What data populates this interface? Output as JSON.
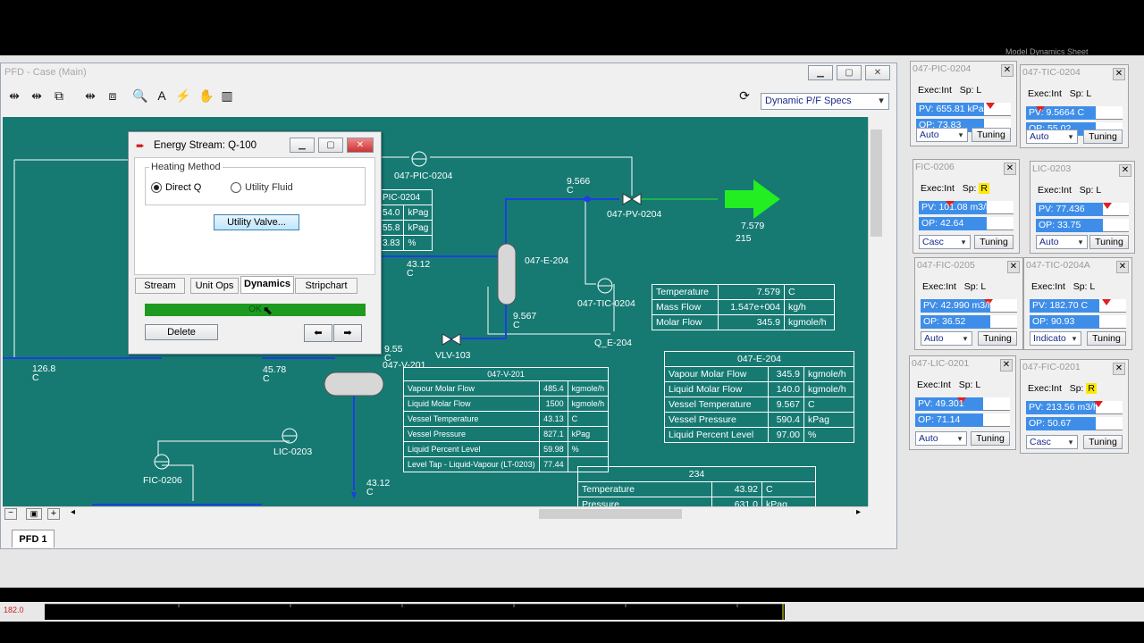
{
  "window": {
    "title": "PFD - Case (Main)",
    "view_select": "Dynamic P/F Specs",
    "tab": "PFD 1",
    "top_right_text": "Model Dynamics Sheet",
    "trend_value": "182.0"
  },
  "dialog": {
    "title": "Energy Stream: Q-100",
    "group_label": "Heating Method",
    "radio_direct": "Direct Q",
    "radio_utility": "Utility Fluid",
    "utility_button": "Utility Valve...",
    "tabs": [
      "Stream",
      "Unit Ops",
      "Dynamics",
      "Stripchart"
    ],
    "status": "OK",
    "delete_button": "Delete"
  },
  "pfd": {
    "labels": {
      "pic_0204": "047-PIC-0204",
      "pv_0204": "047-PV-0204",
      "e_204": "047-E-204",
      "tic_0204": "047-TIC-0204",
      "q_e_204": "Q_E-204",
      "vlv_103": "VLV-103",
      "v_201": "047-V-201",
      "lic_0203": "LIC-0203",
      "fic_0206": "FIC-0206",
      "s1_val": "9.566",
      "s1_unit": "C",
      "s2_val": "7.579",
      "s2_name": "215",
      "s3_val": "43.12",
      "s3_unit": "C",
      "s4_val": "9.567",
      "s4_unit": "C",
      "s5_val": "9.55",
      "s5_unit": "C",
      "s6_val": "126.8",
      "s6_unit": "C",
      "s7_val": "45.78",
      "s7_unit": "C",
      "s8_val": "43.12",
      "s8_unit": "C"
    },
    "pic_table": {
      "title": "PIC-0204",
      "rows": [
        [
          "54.0",
          "kPag"
        ],
        [
          "55.8",
          "kPag"
        ],
        [
          "3.83",
          "%"
        ]
      ]
    },
    "stream215": [
      [
        "Temperature",
        "7.579",
        "C"
      ],
      [
        "Mass Flow",
        "1.547e+004",
        "kg/h"
      ],
      [
        "Molar Flow",
        "345.9",
        "kgmole/h"
      ]
    ],
    "v201": {
      "title": "047-V-201",
      "rows": [
        [
          "Vapour Molar Flow",
          "485.4",
          "kgmole/h"
        ],
        [
          "Liquid Molar Flow",
          "1500",
          "kgmole/h"
        ],
        [
          "Vessel Temperature",
          "43.13",
          "C"
        ],
        [
          "Vessel Pressure",
          "827.1",
          "kPag"
        ],
        [
          "Liquid Percent Level",
          "59.98",
          "%"
        ],
        [
          "Level Tap - Liquid-Vapour (LT-0203)",
          "77.44",
          ""
        ]
      ]
    },
    "e204": {
      "title": "047-E-204",
      "rows": [
        [
          "Vapour Molar Flow",
          "345.9",
          "kgmole/h"
        ],
        [
          "Liquid Molar Flow",
          "140.0",
          "kgmole/h"
        ],
        [
          "Vessel Temperature",
          "9.567",
          "C"
        ],
        [
          "Vessel Pressure",
          "590.4",
          "kPag"
        ],
        [
          "Liquid Percent Level",
          "97.00",
          "%"
        ]
      ]
    },
    "s234": {
      "title": "234",
      "rows": [
        [
          "Temperature",
          "43.92",
          "C"
        ],
        [
          "Pressure",
          "631.0",
          "kPag"
        ]
      ]
    }
  },
  "faceplates": [
    {
      "title": "047-PIC-0204",
      "exec": "Exec:Int",
      "sp": "Sp:",
      "sp_mode": "L",
      "pv": "PV: 655.81 kPag",
      "op": "OP: 73.83",
      "mode": "Auto",
      "tuning": "Tuning",
      "pv_level": 0.78,
      "op_level": 0.74
    },
    {
      "title": "047-TIC-0204",
      "exec": "Exec:Int",
      "sp": "Sp:",
      "sp_mode": "L",
      "pv": "PV: 9.5664 C",
      "op": "OP: 55.02",
      "mode": "Auto",
      "tuning": "Tuning",
      "pv_level": 0.15,
      "op_level": 0.55
    },
    {
      "title": "FIC-0206",
      "exec": "Exec:Int",
      "sp": "Sp:",
      "sp_mode": "R",
      "pv": "PV: 101.08 m3/h",
      "op": "OP: 42.64",
      "mode": "Casc",
      "tuning": "Tuning",
      "pv_level": 0.33,
      "op_level": 0.43
    },
    {
      "title": "LIC-0203",
      "exec": "Exec:Int",
      "sp": "Sp:",
      "sp_mode": "L",
      "pv": "PV: 77.436",
      "op": "OP: 33.75",
      "mode": "Auto",
      "tuning": "Tuning",
      "pv_level": 0.77,
      "op_level": 0.34
    },
    {
      "title": "047-FIC-0205",
      "exec": "Exec:Int",
      "sp": "Sp:",
      "sp_mode": "L",
      "pv": "PV: 42.990 m3/h",
      "op": "OP: 36.52",
      "mode": "Auto",
      "tuning": "Tuning",
      "pv_level": 0.7,
      "op_level": 0.37
    },
    {
      "title": "047-TIC-0204A",
      "exec": "Exec:Int",
      "sp": "Sp:",
      "sp_mode": "L",
      "pv": "PV: 182.70 C",
      "op": "OP: 90.93",
      "mode": "Indicato",
      "tuning": "Tuning",
      "pv_level": 0.8,
      "op_level": 0.91
    },
    {
      "title": "047-LIC-0201",
      "exec": "Exec:Int",
      "sp": "Sp:",
      "sp_mode": "L",
      "pv": "PV: 49.301",
      "op": "OP: 71.14",
      "mode": "Auto",
      "tuning": "Tuning",
      "pv_level": 0.49,
      "op_level": 0.71
    },
    {
      "title": "047-FIC-0201",
      "exec": "Exec:Int",
      "sp": "Sp:",
      "sp_mode": "R",
      "pv": "PV: 213.56 m3/h",
      "op": "OP: 50.67",
      "mode": "Casc",
      "tuning": "Tuning",
      "pv_level": 0.75,
      "op_level": 0.51
    }
  ],
  "colors": {
    "canvas": "#167a73",
    "bar": "#3e8ee9",
    "arrow": "#22ee22",
    "stream_blue": "#1c3fe0"
  }
}
